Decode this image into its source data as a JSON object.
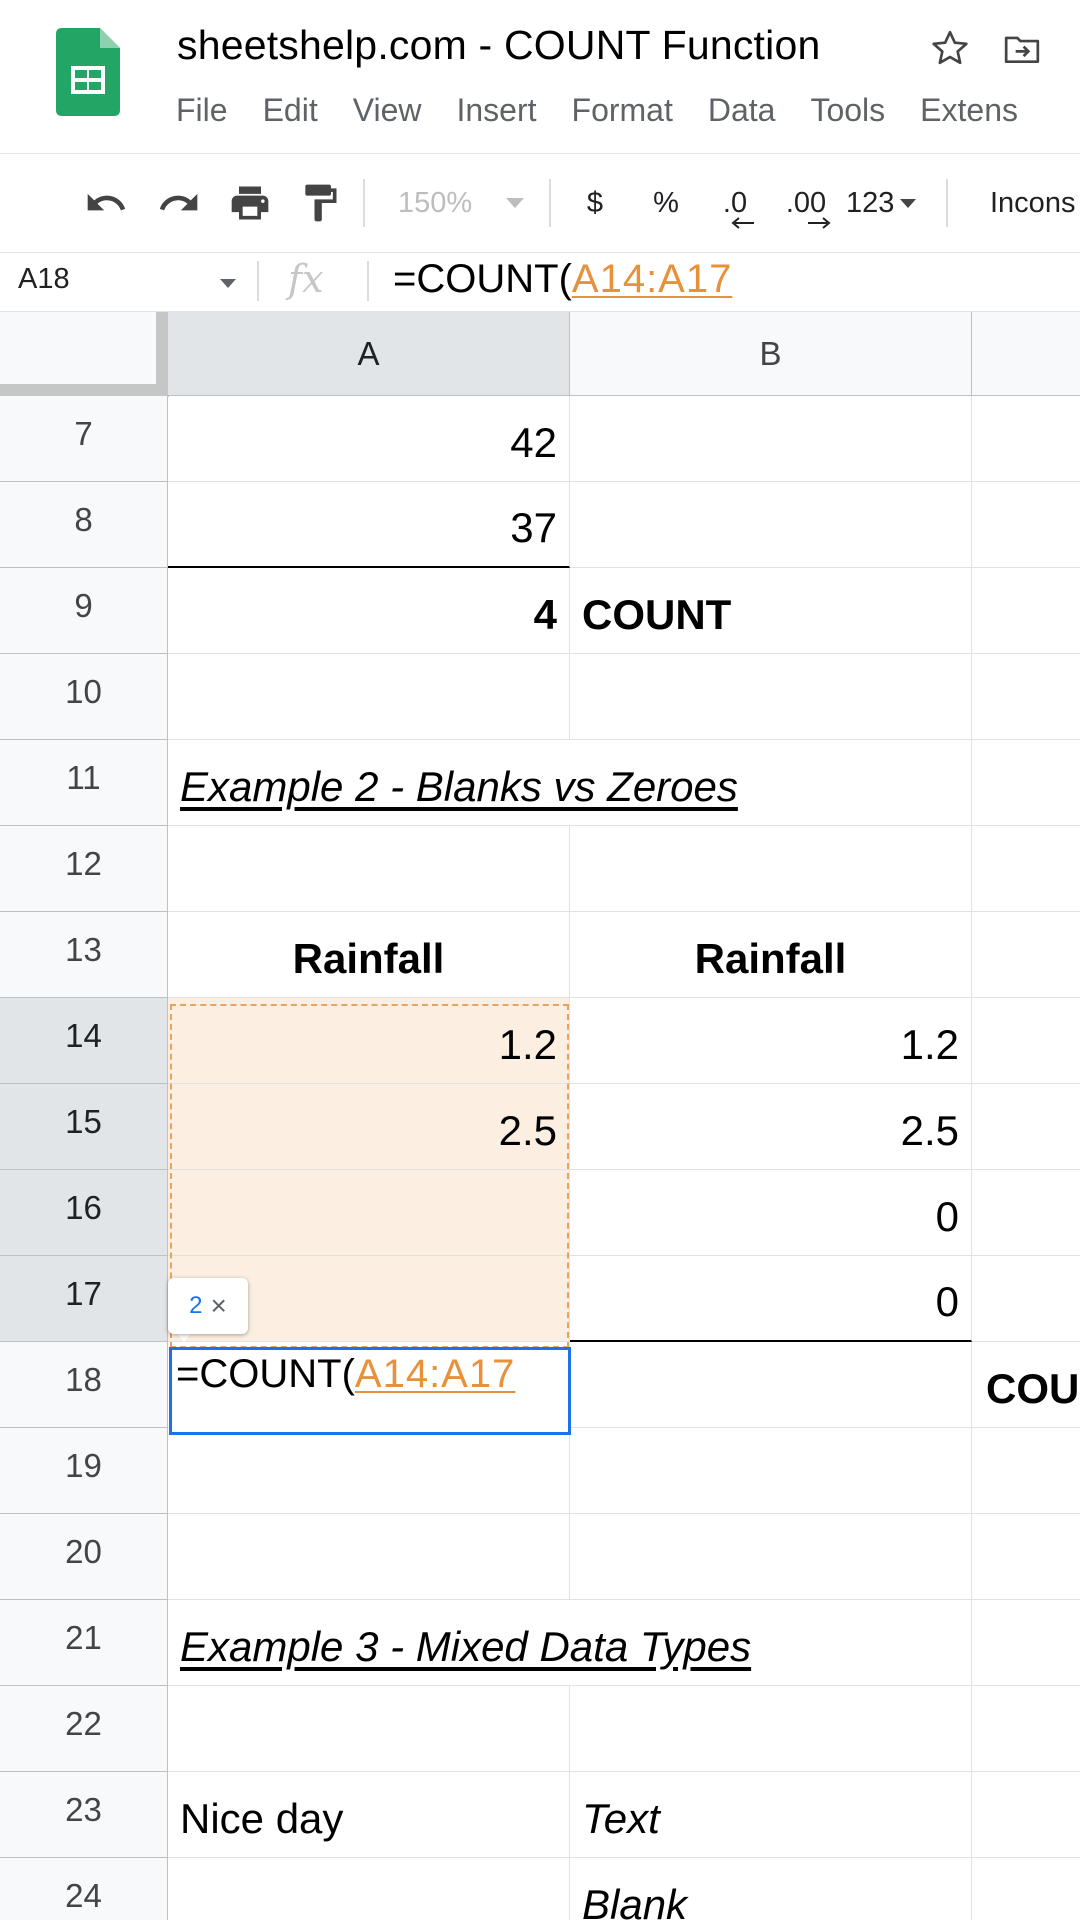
{
  "header": {
    "title": "sheetshelp.com - COUNT Function",
    "menu": [
      "File",
      "Edit",
      "View",
      "Insert",
      "Format",
      "Data",
      "Tools",
      "Extens"
    ]
  },
  "toolbar": {
    "zoom": "150%",
    "currency": "$",
    "percent": "%",
    "dec_decrease": ".0",
    "dec_increase": ".00",
    "number_format": "123",
    "font": "Incons"
  },
  "formula_bar": {
    "cell_ref": "A18",
    "fx": "fx",
    "formula_prefix": "=COUNT(",
    "formula_range": "A14:A17"
  },
  "columns": [
    "A",
    "B"
  ],
  "rows": [
    {
      "num": "7",
      "a": "42",
      "b": ""
    },
    {
      "num": "8",
      "a": "37",
      "b": ""
    },
    {
      "num": "9",
      "a": "4",
      "b": "COUNT"
    },
    {
      "num": "10",
      "a": "",
      "b": ""
    },
    {
      "num": "11",
      "a": "Example 2 - Blanks vs Zeroes",
      "b": ""
    },
    {
      "num": "12",
      "a": "",
      "b": ""
    },
    {
      "num": "13",
      "a": "Rainfall",
      "b": "Rainfall"
    },
    {
      "num": "14",
      "a": "1.2",
      "b": "1.2"
    },
    {
      "num": "15",
      "a": "2.5",
      "b": "2.5"
    },
    {
      "num": "16",
      "a": "",
      "b": "0"
    },
    {
      "num": "17",
      "a": "",
      "b": "0"
    },
    {
      "num": "18",
      "a": "",
      "b": "",
      "c": "COU"
    },
    {
      "num": "19",
      "a": "",
      "b": ""
    },
    {
      "num": "20",
      "a": "",
      "b": ""
    },
    {
      "num": "21",
      "a": "Example 3 - Mixed Data Types",
      "b": ""
    },
    {
      "num": "22",
      "a": "",
      "b": ""
    },
    {
      "num": "23",
      "a": "Nice day",
      "b": "Text"
    },
    {
      "num": "24",
      "a": "",
      "b": "Blank"
    }
  ],
  "editor": {
    "prefix": "=COUNT(",
    "range": "A14:A17",
    "hint_count": "2",
    "hint_close": "×"
  },
  "colors": {
    "accent": "#1a73e8",
    "range_ref": "#e8913b",
    "range_fill": "#fcefe2"
  }
}
